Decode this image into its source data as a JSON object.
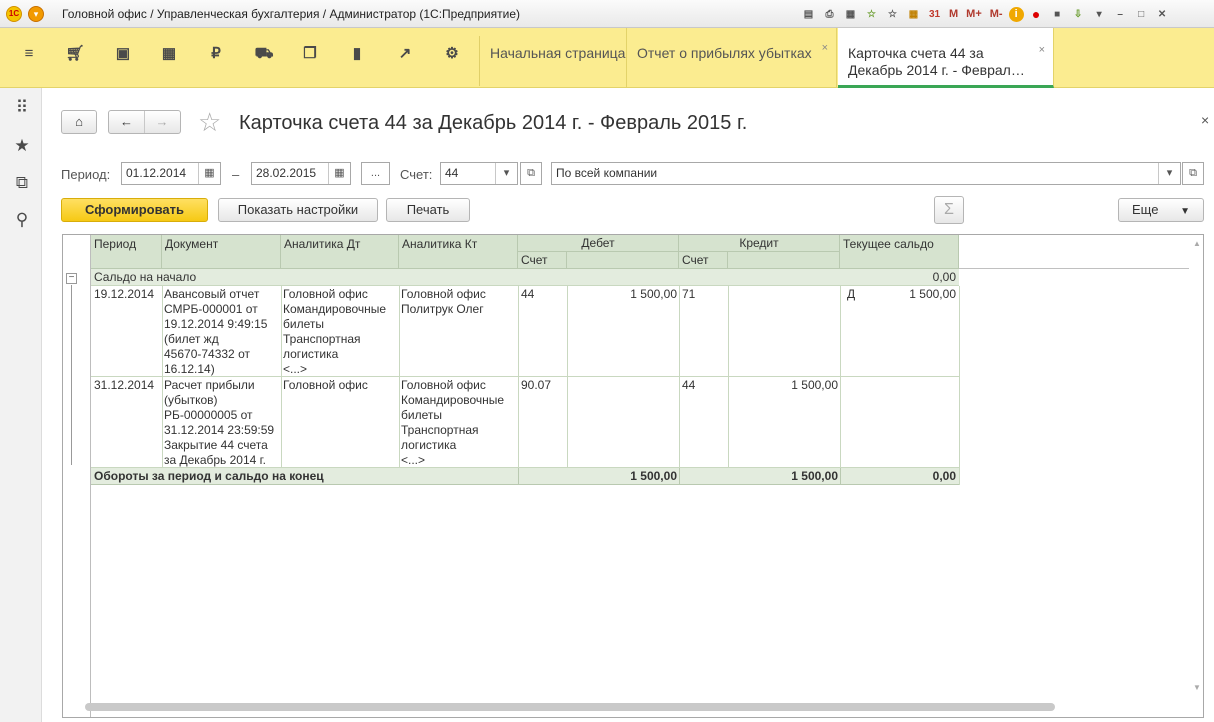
{
  "window": {
    "title": "Головной офис / Управленческая бухгалтерия / Администратор  (1С:Предприятие)"
  },
  "toolbar_icons": [
    "save-icon",
    "print-icon",
    "print-preview-icon",
    "favorite-add-icon",
    "favorites-icon",
    "calculator-icon",
    "calendar-icon"
  ],
  "memory_buttons": [
    "M",
    "M+",
    "M-"
  ],
  "tabs": [
    {
      "label": "Начальная страница"
    },
    {
      "label": "Отчет о прибылях убытках",
      "close": "×"
    },
    {
      "label_line1": "Карточка счета 44 за",
      "label_line2": "Декабрь 2014 г. - Феврал…",
      "close": "×"
    }
  ],
  "page": {
    "title": "Карточка счета 44 за Декабрь 2014 г. - Февраль 2015 г.",
    "close": "×"
  },
  "filters": {
    "period_label": "Период:",
    "date_from": "01.12.2014",
    "dash": "–",
    "date_to": "28.02.2015",
    "ellipsis": "...",
    "account_label": "Счет:",
    "account_value": "44",
    "org_value": "По всей компании"
  },
  "actions": {
    "generate": "Сформировать",
    "settings": "Показать настройки",
    "print": "Печать",
    "sigma": "Σ",
    "more": "Еще"
  },
  "report": {
    "headers": {
      "period": "Период",
      "document": "Документ",
      "analytics_dt": "Аналитика Дт",
      "analytics_kt": "Аналитика Кт",
      "debit": "Дебет",
      "credit": "Кредит",
      "balance": "Текущее сальдо",
      "account": "Счет"
    },
    "opening": {
      "label": "Сальдо на начало",
      "balance": "0,00"
    },
    "rows": [
      {
        "period": "19.12.2014",
        "document": [
          "Авансовый отчет",
          "СМРБ-000001 от",
          "19.12.2014 9:49:15",
          "(билет жд",
          "45670-74332 от",
          "16.12.14)"
        ],
        "analytics_dt": [
          "Головной офис",
          "Командировочные",
          "билеты",
          "Транспортная",
          "логистика",
          "<...>"
        ],
        "analytics_kt": [
          "Головной офис",
          "Политрук Олег"
        ],
        "debit_account": "44",
        "debit_amount": "1 500,00",
        "credit_account": "71",
        "credit_amount": "",
        "balance_side": "Д",
        "balance": "1 500,00"
      },
      {
        "period": "31.12.2014",
        "document": [
          "Расчет прибыли",
          "(убытков)",
          "РБ-00000005 от",
          "31.12.2014 23:59:59",
          "Закрытие 44 счета",
          "за Декабрь 2014 г."
        ],
        "analytics_dt": [
          "Головной офис"
        ],
        "analytics_kt": [
          "Головной офис",
          "Командировочные",
          "билеты",
          "Транспортная",
          "логистика",
          "<...>"
        ],
        "debit_account": "90.07",
        "debit_amount": "",
        "credit_account": "44",
        "credit_amount": "1 500,00",
        "balance_side": "",
        "balance": ""
      }
    ],
    "totals": {
      "label": "Обороты за период и сальдо на конец",
      "debit": "1 500,00",
      "credit": "1 500,00",
      "balance": "0,00"
    }
  }
}
